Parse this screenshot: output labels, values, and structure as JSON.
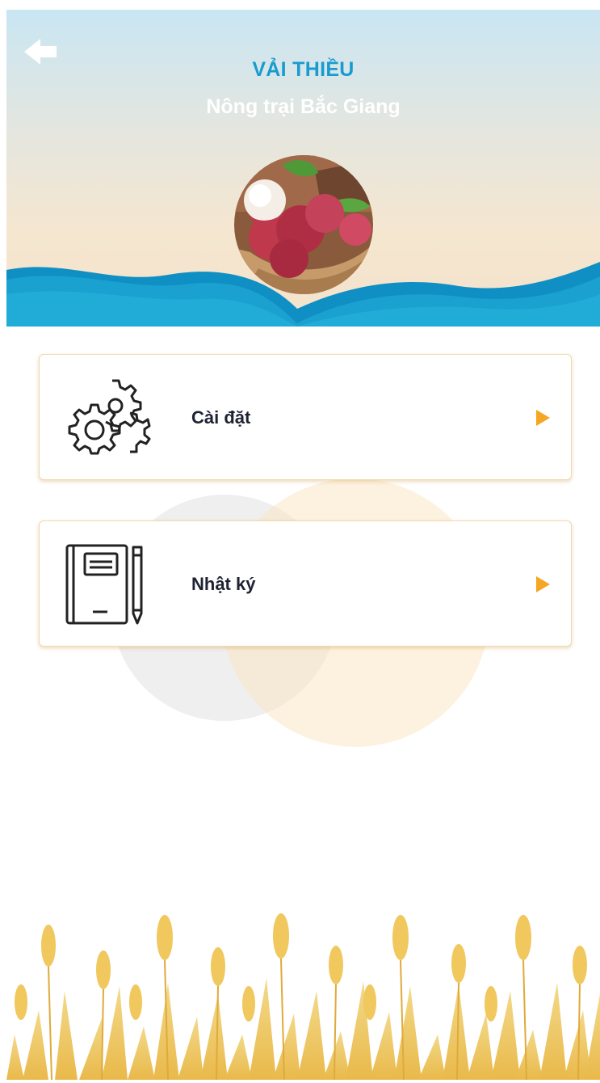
{
  "header": {
    "title": "VẢI THIỀU",
    "subtitle": "Nông trại Bắc Giang",
    "back_icon": "arrow-left-icon",
    "avatar": "lychee-photo"
  },
  "menu": {
    "items": [
      {
        "label": "Cài đặt",
        "icon": "gears-icon",
        "arrow": "triangle-right-icon"
      },
      {
        "label": "Nhật ký",
        "icon": "notebook-icon",
        "arrow": "triangle-right-icon"
      }
    ]
  },
  "footer": {
    "decoration": "wheat-field"
  },
  "colors": {
    "title": "#1a9bd0",
    "subtitle": "#ffffff",
    "wave": "#1aa1cf",
    "card_border": "#f2d9ad",
    "arrow": "#f5a623",
    "label": "#1f2233"
  }
}
